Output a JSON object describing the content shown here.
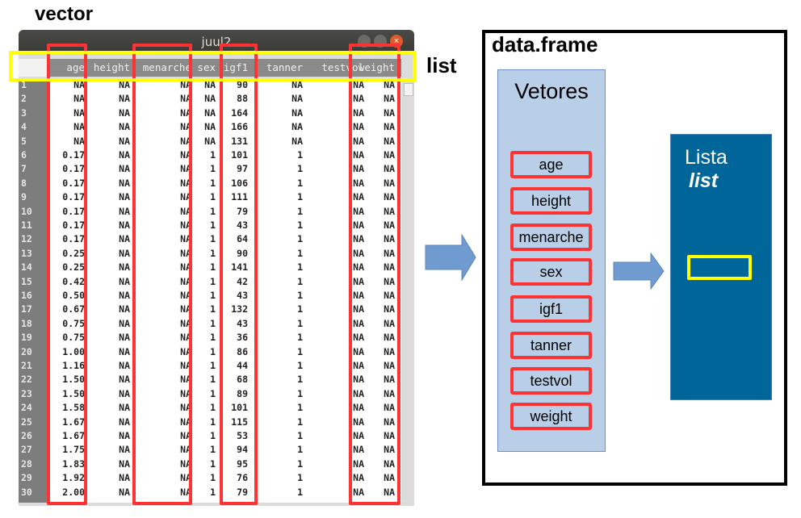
{
  "annotations": {
    "vector_label": "vector",
    "list_label": "list"
  },
  "window": {
    "title": "juul2",
    "close_glyph": "×",
    "icons": [
      "minimize-icon",
      "maximize-icon",
      "close-icon"
    ]
  },
  "table": {
    "columns": [
      "age",
      "height",
      "menarche",
      "sex",
      "igf1",
      "tanner",
      "testvol",
      "weight"
    ],
    "rows": [
      {
        "n": "1",
        "cells": [
          "NA",
          "NA",
          "NA",
          "NA",
          "90",
          "NA",
          "NA",
          "NA"
        ]
      },
      {
        "n": "2",
        "cells": [
          "NA",
          "NA",
          "NA",
          "NA",
          "88",
          "NA",
          "NA",
          "NA"
        ]
      },
      {
        "n": "3",
        "cells": [
          "NA",
          "NA",
          "NA",
          "NA",
          "164",
          "NA",
          "NA",
          "NA"
        ]
      },
      {
        "n": "4",
        "cells": [
          "NA",
          "NA",
          "NA",
          "NA",
          "166",
          "NA",
          "NA",
          "NA"
        ]
      },
      {
        "n": "5",
        "cells": [
          "NA",
          "NA",
          "NA",
          "NA",
          "131",
          "NA",
          "NA",
          "NA"
        ]
      },
      {
        "n": "6",
        "cells": [
          "0.17",
          "NA",
          "NA",
          "1",
          "101",
          "1",
          "NA",
          "NA"
        ]
      },
      {
        "n": "7",
        "cells": [
          "0.17",
          "NA",
          "NA",
          "1",
          "97",
          "1",
          "NA",
          "NA"
        ]
      },
      {
        "n": "8",
        "cells": [
          "0.17",
          "NA",
          "NA",
          "1",
          "106",
          "1",
          "NA",
          "NA"
        ]
      },
      {
        "n": "9",
        "cells": [
          "0.17",
          "NA",
          "NA",
          "1",
          "111",
          "1",
          "NA",
          "NA"
        ]
      },
      {
        "n": "10",
        "cells": [
          "0.17",
          "NA",
          "NA",
          "1",
          "79",
          "1",
          "NA",
          "NA"
        ]
      },
      {
        "n": "11",
        "cells": [
          "0.17",
          "NA",
          "NA",
          "1",
          "43",
          "1",
          "NA",
          "NA"
        ]
      },
      {
        "n": "12",
        "cells": [
          "0.17",
          "NA",
          "NA",
          "1",
          "64",
          "1",
          "NA",
          "NA"
        ]
      },
      {
        "n": "13",
        "cells": [
          "0.25",
          "NA",
          "NA",
          "1",
          "90",
          "1",
          "NA",
          "NA"
        ]
      },
      {
        "n": "14",
        "cells": [
          "0.25",
          "NA",
          "NA",
          "1",
          "141",
          "1",
          "NA",
          "NA"
        ]
      },
      {
        "n": "15",
        "cells": [
          "0.42",
          "NA",
          "NA",
          "1",
          "42",
          "1",
          "NA",
          "NA"
        ]
      },
      {
        "n": "16",
        "cells": [
          "0.50",
          "NA",
          "NA",
          "1",
          "43",
          "1",
          "NA",
          "NA"
        ]
      },
      {
        "n": "17",
        "cells": [
          "0.67",
          "NA",
          "NA",
          "1",
          "132",
          "1",
          "NA",
          "NA"
        ]
      },
      {
        "n": "18",
        "cells": [
          "0.75",
          "NA",
          "NA",
          "1",
          "43",
          "1",
          "NA",
          "NA"
        ]
      },
      {
        "n": "19",
        "cells": [
          "0.75",
          "NA",
          "NA",
          "1",
          "36",
          "1",
          "NA",
          "NA"
        ]
      },
      {
        "n": "20",
        "cells": [
          "1.00",
          "NA",
          "NA",
          "1",
          "86",
          "1",
          "NA",
          "NA"
        ]
      },
      {
        "n": "21",
        "cells": [
          "1.16",
          "NA",
          "NA",
          "1",
          "44",
          "1",
          "NA",
          "NA"
        ]
      },
      {
        "n": "22",
        "cells": [
          "1.50",
          "NA",
          "NA",
          "1",
          "68",
          "1",
          "NA",
          "NA"
        ]
      },
      {
        "n": "23",
        "cells": [
          "1.50",
          "NA",
          "NA",
          "1",
          "89",
          "1",
          "NA",
          "NA"
        ]
      },
      {
        "n": "24",
        "cells": [
          "1.58",
          "NA",
          "NA",
          "1",
          "101",
          "1",
          "NA",
          "NA"
        ]
      },
      {
        "n": "25",
        "cells": [
          "1.67",
          "NA",
          "NA",
          "1",
          "115",
          "1",
          "NA",
          "NA"
        ]
      },
      {
        "n": "26",
        "cells": [
          "1.67",
          "NA",
          "NA",
          "1",
          "53",
          "1",
          "NA",
          "NA"
        ]
      },
      {
        "n": "27",
        "cells": [
          "1.75",
          "NA",
          "NA",
          "1",
          "94",
          "1",
          "NA",
          "NA"
        ]
      },
      {
        "n": "28",
        "cells": [
          "1.83",
          "NA",
          "NA",
          "1",
          "95",
          "1",
          "NA",
          "NA"
        ]
      },
      {
        "n": "29",
        "cells": [
          "1.92",
          "NA",
          "NA",
          "1",
          "76",
          "1",
          "NA",
          "NA"
        ]
      },
      {
        "n": "30",
        "cells": [
          "2.00",
          "NA",
          "NA",
          "1",
          "79",
          "1",
          "NA",
          "NA"
        ]
      }
    ],
    "highlighted_columns": [
      "age",
      "menarche",
      "igf1",
      "weight"
    ]
  },
  "diagram": {
    "frame_title": "data.frame",
    "vetores_title": "Vetores",
    "vectors": [
      "age",
      "height",
      "menarche",
      "sex",
      "igf1",
      "tanner",
      "testvol",
      "weight"
    ],
    "lista_title": "Lista",
    "lista_subtitle": "list"
  },
  "colors": {
    "highlight_red": "#ff3333",
    "highlight_yellow": "#ffff00",
    "vetores_fill": "#b9cfe8",
    "lista_fill": "#006699",
    "arrow_fill": "#6f9bd1"
  }
}
